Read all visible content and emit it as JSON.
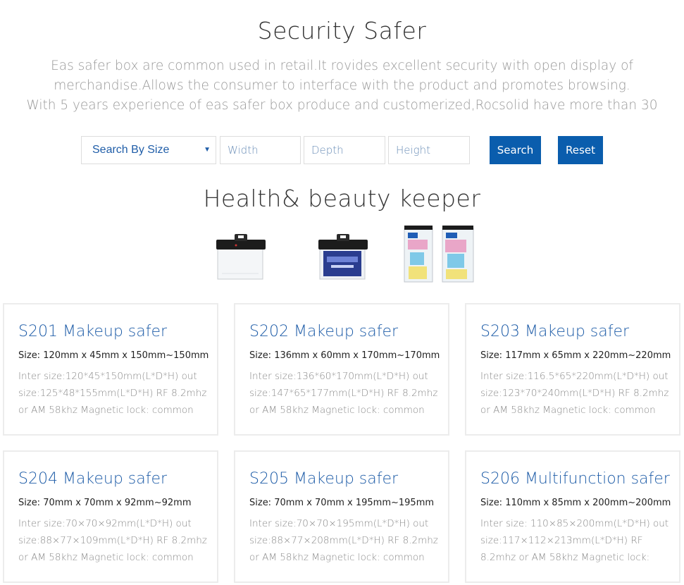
{
  "header": {
    "title": "Security Safer",
    "intro_lines": [
      "Eas safer box are common used in retail.It rovides excellent security with open display of",
      "merchandise.Allows the consumer to interface with the product and promotes browsing.",
      "With 5 years experience of eas safer box produce and customerized,Rocsolid have more than 30"
    ]
  },
  "search": {
    "select_value": "Search By Size",
    "width_placeholder": "Width",
    "depth_placeholder": "Depth",
    "height_placeholder": "Height",
    "search_label": "Search",
    "reset_label": "Reset"
  },
  "section": {
    "title": "Health& beauty keeper"
  },
  "colors": {
    "accent": "#0a5dad",
    "link": "#1f5da8",
    "muted": "#999999",
    "border": "#ececec"
  },
  "products": [
    {
      "title": "S201 Makeup safer",
      "size": "Size: 120mm x 45mm x 150mm~150mm",
      "desc": "Inter size:120*45*150mm(L*D*H) out size:125*48*155mm(L*D*H) RF 8.2mhz or AM 58khz Magnetic lock: common lock"
    },
    {
      "title": "S202 Makeup safer",
      "size": "Size: 136mm x 60mm x 170mm~170mm",
      "desc": "Inter size:136*60*170mm(L*D*H) out size:147*65*177mm(L*D*H) RF 8.2mhz or AM 58khz Magnetic lock: common lock"
    },
    {
      "title": "S203 Makeup safer",
      "size": "Size: 117mm x 65mm x 220mm~220mm",
      "desc": "Inter size:116.5*65*220mm(L*D*H) out size:123*70*240mm(L*D*H) RF 8.2mhz or AM 58khz Magnetic lock: common lock"
    },
    {
      "title": "S204 Makeup safer",
      "size": "Size: 70mm x 70mm x 92mm~92mm",
      "desc": "Inter size:70×70×92mm(L*D*H) out size:88×77×109mm(L*D*H) RF 8.2mhz or AM 58khz Magnetic lock: common lock or"
    },
    {
      "title": "S205 Makeup safer",
      "size": "Size: 70mm x 70mm x 195mm~195mm",
      "desc": "Inter size:70×70×195mm(L*D*H) out size:88×77×208mm(L*D*H) RF 8.2mhz or AM 58khz Magnetic lock: common lock or"
    },
    {
      "title": "S206 Multifunction safer",
      "size": "Size: 110mm x 85mm x 200mm~200mm",
      "desc": "Inter size: 110×85×200mm(L*D*H) out size:117×112×213mm(L*D*H) RF 8.2mhz or AM 58khz Magnetic lock: common lock"
    }
  ]
}
